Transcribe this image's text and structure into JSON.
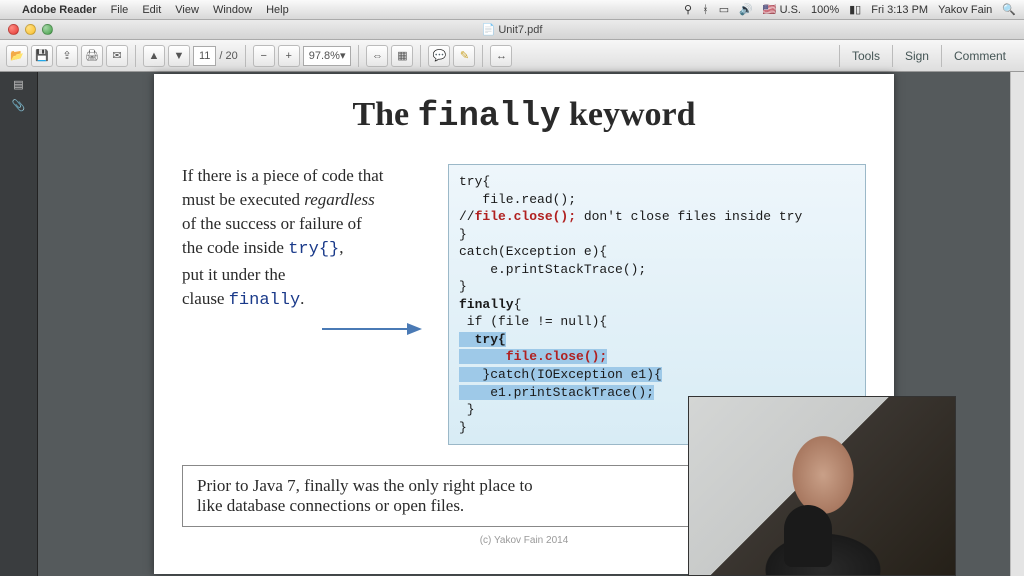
{
  "menubar": {
    "apple": "",
    "app": "Adobe Reader",
    "items": [
      "File",
      "Edit",
      "View",
      "Window",
      "Help"
    ],
    "status": {
      "flag": "U.S.",
      "battery": "100%",
      "datetime": "Fri 3:13 PM",
      "user": "Yakov Fain"
    }
  },
  "window": {
    "title": "Unit7.pdf"
  },
  "toolbar": {
    "page_current": "11",
    "page_sep": "/",
    "page_total": "20",
    "zoom": "97.8%",
    "panes": {
      "tools": "Tools",
      "sign": "Sign",
      "comment": "Comment"
    },
    "icons": [
      "save-icon",
      "print-icon",
      "mail-icon",
      "export-icon",
      "first-page-icon",
      "prev-page-icon",
      "next-page-icon",
      "last-page-icon",
      "zoom-out-icon",
      "zoom-in-icon",
      "fit-icon",
      "rotate-icon",
      "highlight-icon",
      "note-icon",
      "share-icon"
    ]
  },
  "slide": {
    "title_pre": "The ",
    "title_mono": "finally",
    "title_post": " keyword",
    "left_l1": "If there is a piece of code that",
    "left_l2a": "must be executed ",
    "left_l2b_i": "regardless",
    "left_l3": "of the success or failure of",
    "left_l4a": "the code inside ",
    "left_l4b": "try{}",
    "left_l4c": ",",
    "left_l5": " put it under the",
    "left_l6a": "clause ",
    "left_l6b": "finally",
    "left_l6c": ".",
    "code": {
      "l1": "try{",
      "l2": "   file.read();",
      "l3a": "//",
      "l3b": "file.close();",
      "l3c": " don't close files inside try",
      "l4": "}",
      "l5": "catch(Exception e){",
      "l6": "    e.printStackTrace();",
      "l7": "}",
      "l8": "finally",
      "l8b": "{",
      "l9": " if (file != null){",
      "l10": "  try{",
      "l11": "      file.close();",
      "l12": "   }catch(IOException e1){",
      "l13": "    e1.printStackTrace();",
      "l14": " }",
      "l15": "}"
    },
    "bottom_l1": "Prior to Java 7, finally was the only right place to",
    "bottom_l2": "like database connections or open files.",
    "copyright": "(c) Yakov Fain  2014"
  }
}
